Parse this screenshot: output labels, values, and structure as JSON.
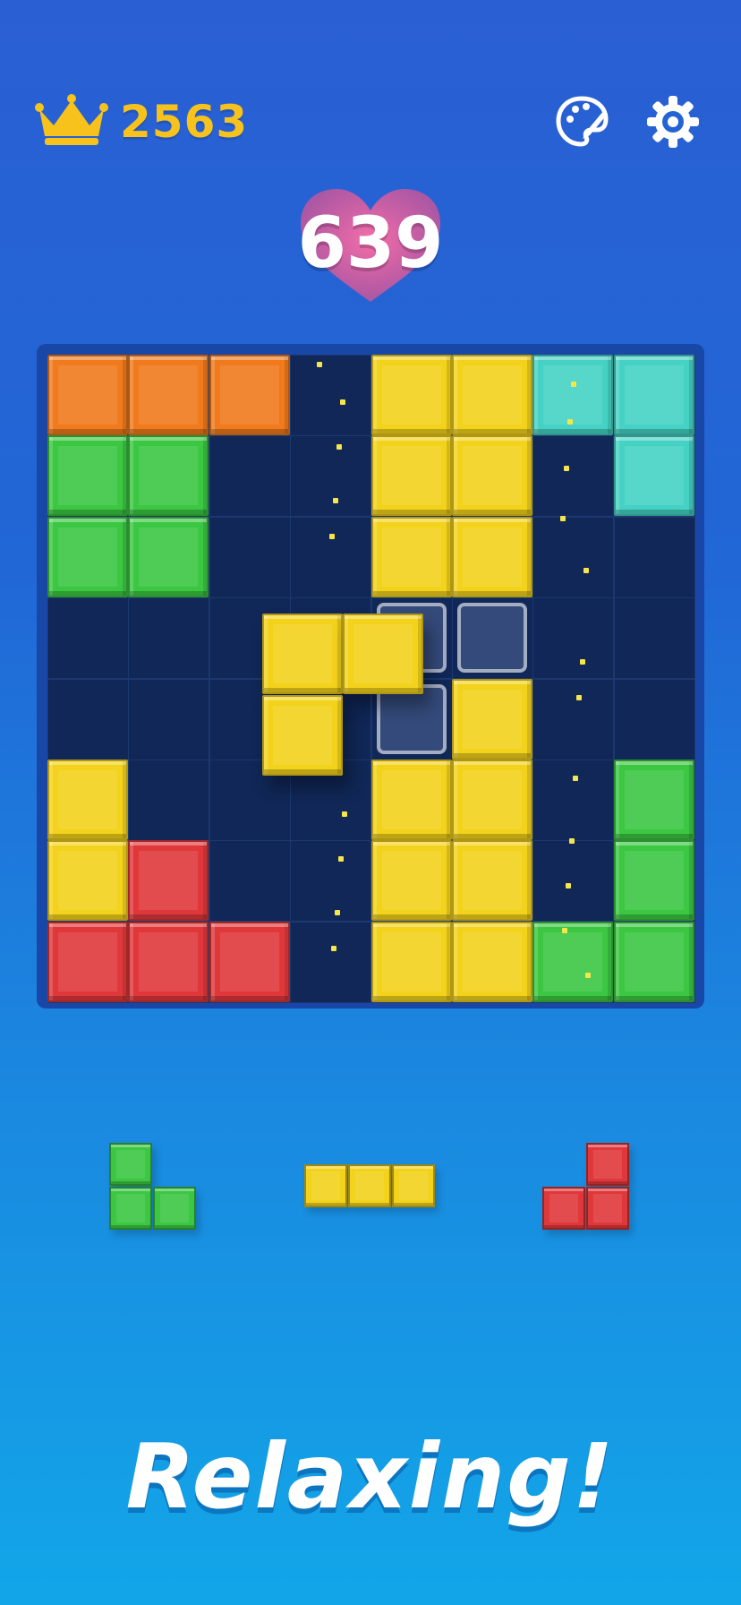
{
  "header": {
    "best_score": "2563",
    "current_score": "639",
    "icons": [
      "crown-icon",
      "palette-icon",
      "gear-icon",
      "heart-icon"
    ]
  },
  "colors": {
    "orange": "#f07a1c",
    "yellow": "#f3d21c",
    "cyan": "#45d2c4",
    "green": "#3cc742",
    "red": "#e0383a",
    "board_dark": "#0e2454",
    "gold": "#f7c21c"
  },
  "board": {
    "rows": 8,
    "cols": 8,
    "cells": [
      [
        "orange",
        "orange",
        "orange",
        null,
        "yellow",
        "yellow",
        "cyan",
        "cyan"
      ],
      [
        "green",
        "green",
        null,
        null,
        "yellow",
        "yellow",
        null,
        "cyan"
      ],
      [
        "green",
        "green",
        null,
        null,
        "yellow",
        "yellow",
        null,
        null
      ],
      [
        null,
        null,
        null,
        null,
        null,
        null,
        null,
        null
      ],
      [
        null,
        null,
        null,
        null,
        null,
        "yellow",
        null,
        null
      ],
      [
        "yellow",
        null,
        null,
        null,
        "yellow",
        "yellow",
        null,
        "green"
      ],
      [
        "yellow",
        "red",
        null,
        null,
        "yellow",
        "yellow",
        null,
        "green"
      ],
      [
        "red",
        "red",
        "red",
        null,
        "yellow",
        "yellow",
        "green",
        "green"
      ]
    ],
    "ghost_cells": [
      [
        3,
        4
      ],
      [
        3,
        5
      ],
      [
        4,
        4
      ]
    ],
    "dragged_piece": {
      "color": "yellow",
      "cells": [
        [
          0,
          0
        ],
        [
          0,
          1
        ],
        [
          1,
          0
        ]
      ]
    }
  },
  "tray": [
    {
      "color": "green",
      "cells": [
        [
          0,
          0
        ],
        [
          1,
          0
        ],
        [
          1,
          1
        ]
      ]
    },
    {
      "color": "yellow",
      "cells": [
        [
          0,
          0
        ],
        [
          0,
          1
        ],
        [
          0,
          2
        ]
      ]
    },
    {
      "color": "red",
      "cells": [
        [
          0,
          1
        ],
        [
          1,
          0
        ],
        [
          1,
          1
        ]
      ]
    }
  ],
  "tagline": "Relaxing!"
}
